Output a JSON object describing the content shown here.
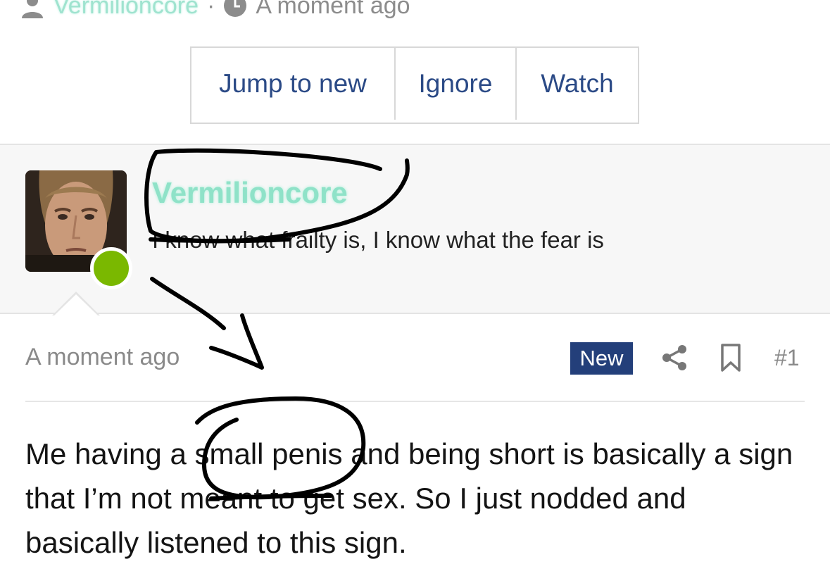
{
  "thread_meta": {
    "author": "Vermilioncore",
    "separator": "·",
    "time": "A moment ago"
  },
  "actions": {
    "jump_label": "Jump to new",
    "ignore_label": "Ignore",
    "watch_label": "Watch"
  },
  "member": {
    "name": "Vermilioncore",
    "title": "I know what frailty is, I know what the fear is",
    "online_color": "#7ab800",
    "name_color": "#8fe2c8"
  },
  "post": {
    "time": "A moment ago",
    "badge": "New",
    "number": "#1",
    "body": "Me having a small penis and being short is basically a sign that I’m not meant to get sex. So I just nodded and basically listened to this sign."
  },
  "icons": [
    "user-icon",
    "clock-icon",
    "share-icon",
    "bookmark-icon"
  ],
  "colors": {
    "link": "#2b4a86",
    "badge_bg": "#233f7a",
    "muted": "#8a8a8a"
  }
}
